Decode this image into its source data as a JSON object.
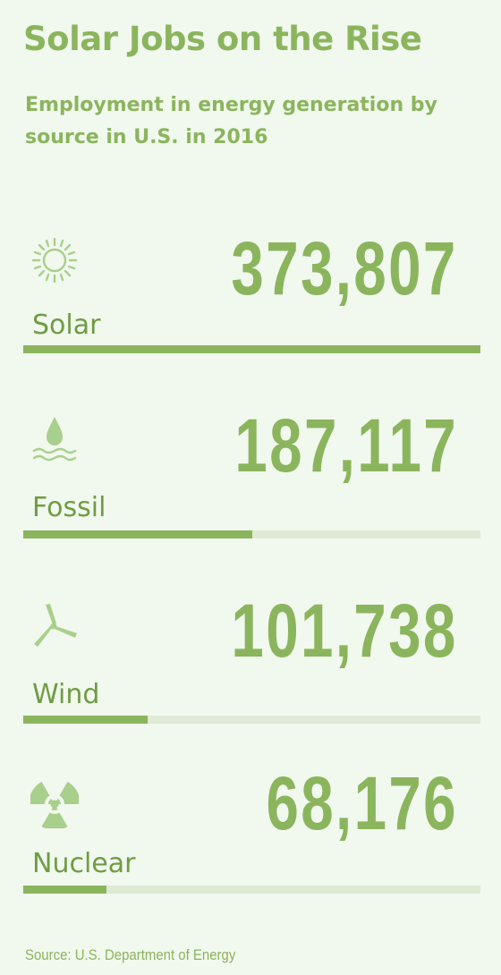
{
  "header": {
    "title": "Solar Jobs on the Rise",
    "subtitle": "Employment in energy generation by source in U.S. in 2016"
  },
  "colors": {
    "accent": "#8bb55d",
    "label": "#6f9c43",
    "track": "#dfead5",
    "icon": "#a9cf8c",
    "background": "#f1f8ee"
  },
  "rows": [
    {
      "icon": "sun-icon",
      "value_text": "373,807",
      "label": "Solar"
    },
    {
      "icon": "water-drop-icon",
      "value_text": "187,117",
      "label": "Fossil"
    },
    {
      "icon": "wind-turbine-icon",
      "value_text": "101,738",
      "label": "Wind"
    },
    {
      "icon": "radiation-icon",
      "value_text": "68,176",
      "label": "Nuclear"
    }
  ],
  "chart_data": {
    "type": "bar",
    "categories": [
      "Solar",
      "Fossil",
      "Wind",
      "Nuclear"
    ],
    "values": [
      373807,
      187117,
      101738,
      68176
    ],
    "title": "Solar Jobs on the Rise",
    "subtitle": "Employment in energy generation by source in U.S. in 2016",
    "xlabel": "",
    "ylabel": "",
    "ylim": [
      0,
      373807
    ],
    "grid": false
  },
  "footer": {
    "source": "Source: U.S. Department of Energy"
  }
}
